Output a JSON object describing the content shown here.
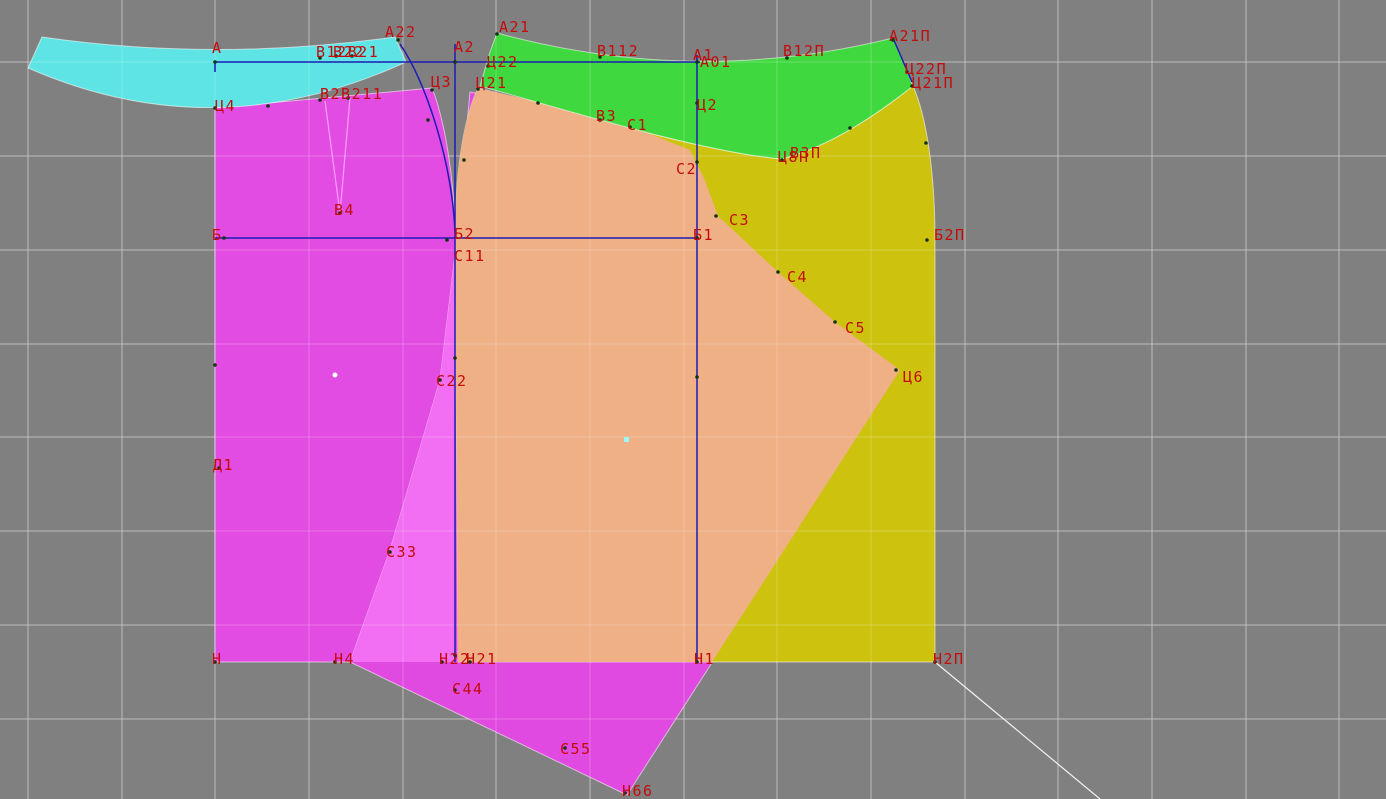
{
  "colors": {
    "background": "#808080",
    "grid": "#a9a9a9",
    "waistband": "#5ee4e4",
    "yoke": "#3fd93f",
    "front_panel": "#e24ce2",
    "rotated_panel": "#e04ae0",
    "panel_overlap": "#f26ef2",
    "back_panel": "#cdc30f",
    "back_overlap": "#eeb084",
    "construction_line": "#1c1cb4",
    "label": "#c40c0c",
    "point": "#123412",
    "guide_line": "#f2f2f2"
  },
  "labels": [
    "А22",
    "А21",
    "А2",
    "А",
    "В12В21",
    "В22",
    "Ц4",
    "В2В211",
    "Ц3",
    "Ц21",
    "Ц22",
    "В112",
    "А1",
    "А01",
    "В12П",
    "А21П",
    "Ц22П",
    "Ц21П",
    "Ц2",
    "В3",
    "С1",
    "С2",
    "Ц8П",
    "В3П",
    "В4",
    "Б",
    "Б2",
    "Б1",
    "С3",
    "Б2П",
    "С11",
    "С4",
    "С5",
    "Ц6",
    "С22",
    "Д1",
    "С33",
    "Н",
    "Н4",
    "Н22",
    "Н21",
    "Н1",
    "Н2П",
    "С44",
    "С55",
    "Н66"
  ]
}
